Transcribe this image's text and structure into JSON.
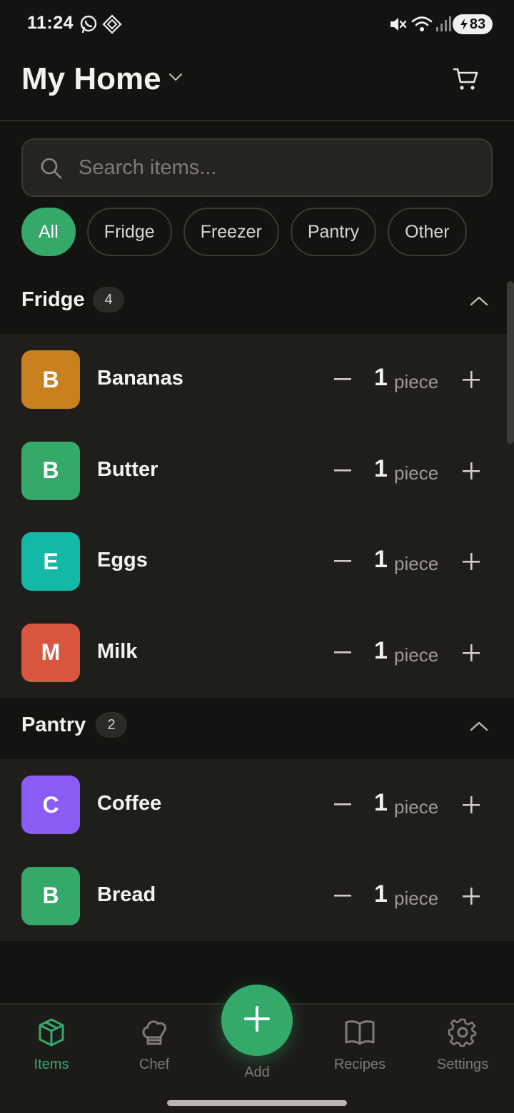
{
  "status_bar": {
    "time": "11:24",
    "battery": "83",
    "icons": [
      "whatsapp-icon",
      "app-notification-icon",
      "mute-icon",
      "wifi-icon",
      "signal-icon",
      "battery-icon"
    ]
  },
  "header": {
    "title": "My Home",
    "dropdown_icon": "chevron-down-icon",
    "cart_icon": "cart-icon"
  },
  "search": {
    "placeholder": "Search items...",
    "value": ""
  },
  "filters": {
    "chips": [
      "All",
      "Fridge",
      "Freezer",
      "Pantry",
      "Other"
    ],
    "selected": "All"
  },
  "sections": [
    {
      "title": "Fridge",
      "count": "4",
      "items": [
        {
          "letter": "B",
          "name": "Bananas",
          "qty": "1",
          "unit": "piece",
          "color": "#c9801f"
        },
        {
          "letter": "B",
          "name": "Butter",
          "qty": "1",
          "unit": "piece",
          "color": "#34a96a"
        },
        {
          "letter": "E",
          "name": "Eggs",
          "qty": "1",
          "unit": "piece",
          "color": "#14b8a6"
        },
        {
          "letter": "M",
          "name": "Milk",
          "qty": "1",
          "unit": "piece",
          "color": "#d9563f"
        }
      ]
    },
    {
      "title": "Pantry",
      "count": "2",
      "items": [
        {
          "letter": "C",
          "name": "Coffee",
          "qty": "1",
          "unit": "piece",
          "color": "#8b5cf6"
        },
        {
          "letter": "B",
          "name": "Bread",
          "qty": "1",
          "unit": "piece",
          "color": "#34a96a"
        }
      ]
    }
  ],
  "bottom_nav": {
    "items": [
      {
        "label": "Items",
        "icon": "box-icon",
        "active": true
      },
      {
        "label": "Chef",
        "icon": "chef-hat-icon",
        "active": false
      },
      {
        "label": "Add",
        "icon": "plus-icon",
        "active": false
      },
      {
        "label": "Recipes",
        "icon": "book-icon",
        "active": false
      },
      {
        "label": "Settings",
        "icon": "gear-icon",
        "active": false
      }
    ]
  },
  "colors": {
    "accent": "#34a96a",
    "background": "#131311",
    "surface": "#1f1e1b"
  }
}
